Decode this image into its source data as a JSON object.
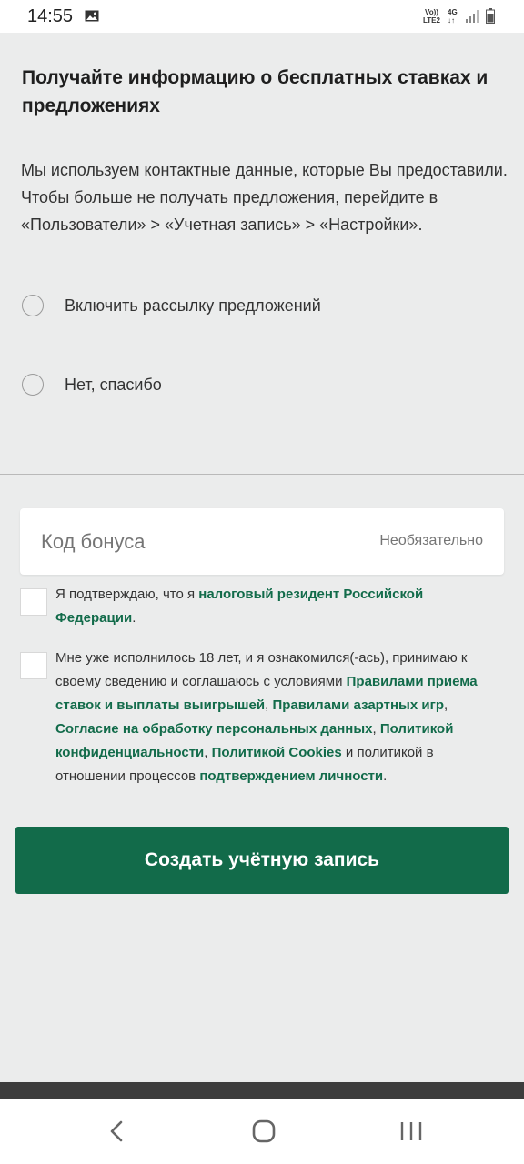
{
  "status_bar": {
    "time": "14:55",
    "network_volte": "Vo))",
    "network_lte": "LTE2",
    "network_4g": "4G",
    "icons": [
      "image-icon",
      "signal-icon",
      "battery-icon"
    ]
  },
  "offers": {
    "title": "Получайте информацию о бесплатных ставках и предложениях",
    "info": "Мы используем контактные данные, которые Вы предоставили. Чтобы больше не получать предложения, перейдите в «Пользователи» > «Учетная запись» > «Настройки».",
    "options": [
      {
        "label": "Включить рассылку предложений",
        "selected": false
      },
      {
        "label": "Нет, спасибо",
        "selected": false
      }
    ]
  },
  "bonus": {
    "placeholder": "Код бонуса",
    "optional_label": "Необязательно",
    "value": ""
  },
  "confirmations": {
    "tax_resident": {
      "checked": false,
      "text_before": "Я подтверждаю, что я ",
      "link": "налоговый резидент Российской Федерации",
      "text_after": "."
    },
    "terms": {
      "checked": false,
      "text_1": "Мне уже исполнилось 18 лет, и я ознакомился(-ась), принимаю к своему сведению и соглашаюсь с условиями ",
      "link_1": "Правилами приема ставок и выплаты выигрышей",
      "sep_1": ", ",
      "link_2": "Правилами азартных игр",
      "sep_2": ", ",
      "link_3": "Согласие на обработку персональных данных",
      "sep_3": ", ",
      "link_4": "Политикой конфиденциальности",
      "sep_4": ", ",
      "link_5": "Политикой Cookies",
      "text_2": " и политикой в отношении процессов ",
      "link_6": "подтверждением личности",
      "text_3": "."
    }
  },
  "actions": {
    "create_account_label": "Создать учётную запись"
  },
  "colors": {
    "brand_green": "#126b4a",
    "background": "#ebecec"
  },
  "nav_bar": {
    "icons": [
      "back-icon",
      "home-icon",
      "recent-apps-icon"
    ]
  }
}
